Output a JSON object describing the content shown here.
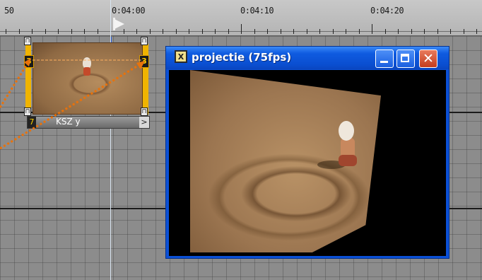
{
  "ruler": {
    "timecodes": [
      "50",
      "0:04:00",
      "0:04:10",
      "0:04:20"
    ]
  },
  "clip": {
    "keyframe_left": "3",
    "keyframe_right": "3",
    "label": "KSZ y",
    "index": "7",
    "arrow": ">",
    "handle_glyph": "⊓"
  },
  "window": {
    "title": "projectie (75fps)",
    "app_icon_glyph": "X",
    "close_glyph": "✕"
  },
  "colors": {
    "titlebar": "#0a4ed0",
    "clip_accent": "#f0b400",
    "motion_path": "#e8720c"
  }
}
